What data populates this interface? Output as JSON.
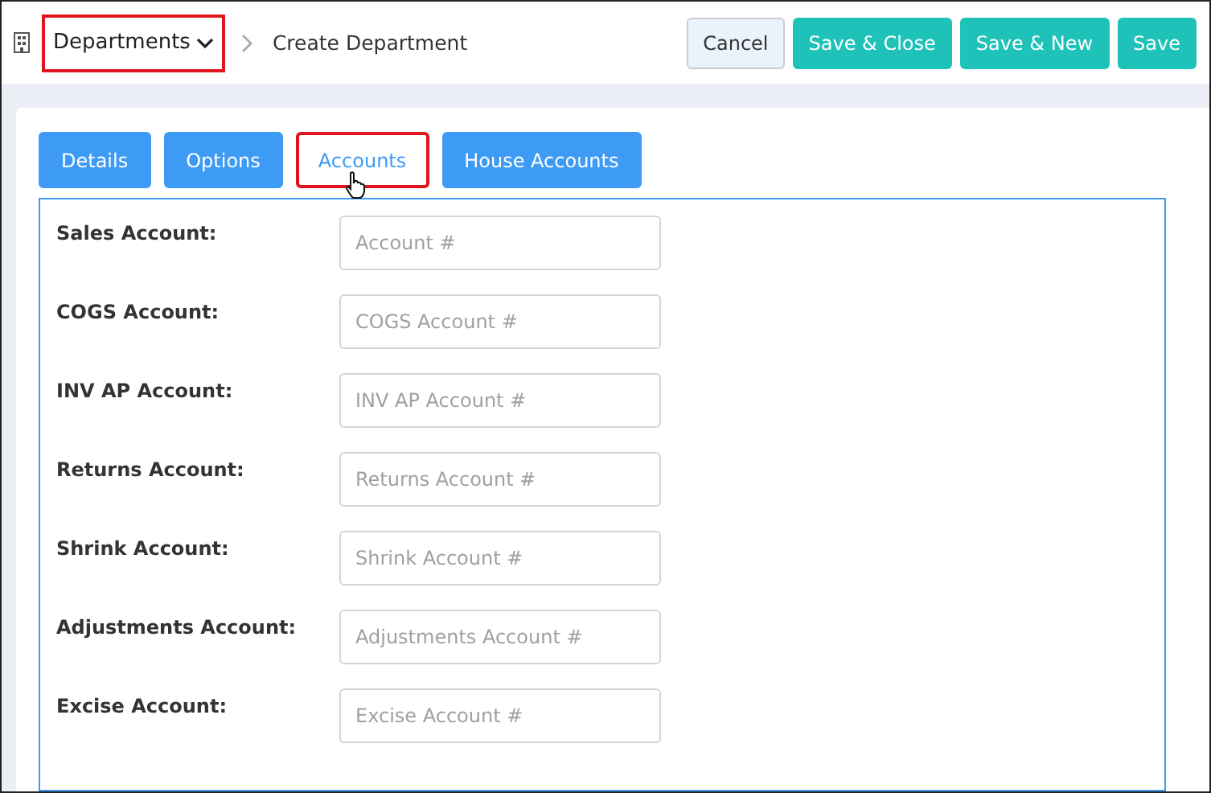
{
  "breadcrumb": {
    "section": "Departments",
    "highlighted": true,
    "current": "Create Department"
  },
  "actions": [
    {
      "label": "Cancel",
      "kind": "secondary"
    },
    {
      "label": "Save & Close",
      "kind": "primary"
    },
    {
      "label": "Save & New",
      "kind": "primary"
    },
    {
      "label": "Save",
      "kind": "primary"
    }
  ],
  "tabs": [
    {
      "label": "Details",
      "selected": false,
      "highlighted": false
    },
    {
      "label": "Options",
      "selected": false,
      "highlighted": false
    },
    {
      "label": "Accounts",
      "selected": true,
      "highlighted": true
    },
    {
      "label": "House Accounts",
      "selected": false,
      "highlighted": false
    }
  ],
  "fields": [
    {
      "label": "Sales Account:",
      "placeholder": "Account #"
    },
    {
      "label": "COGS Account:",
      "placeholder": "COGS Account #"
    },
    {
      "label": "INV AP Account:",
      "placeholder": "INV AP Account #"
    },
    {
      "label": "Returns Account:",
      "placeholder": "Returns Account #"
    },
    {
      "label": "Shrink Account:",
      "placeholder": "Shrink Account #"
    },
    {
      "label": "Adjustments Account:",
      "placeholder": "Adjustments Account #"
    },
    {
      "label": "Excise Account:",
      "placeholder": "Excise Account #"
    }
  ]
}
